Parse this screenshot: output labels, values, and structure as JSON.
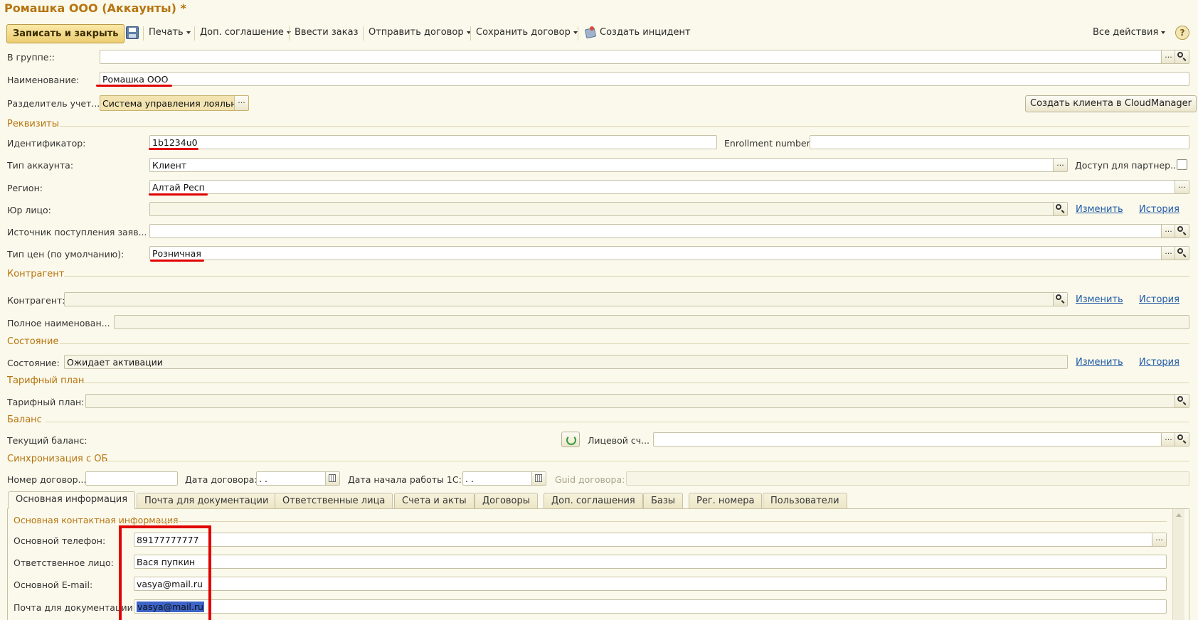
{
  "window_title": "Ромашка ООО (Аккаунты) *",
  "toolbar": {
    "save_close": "Записать и закрыть",
    "print": "Печать",
    "dop_sogl": "Доп. соглашение",
    "vvesti_zakaz": "Ввести заказ",
    "send_contract": "Отправить договор",
    "save_contract": "Сохранить договор",
    "create_incident": "Создать инцидент",
    "all_actions": "Все действия",
    "help": "?"
  },
  "form": {
    "v_gruppe_label": "В группе::",
    "v_gruppe_value": "",
    "name_label": "Наименование:",
    "name_value": "Ромашка ООО",
    "divider_label": "Разделитель учет...",
    "divider_value": "Система управления лояльн",
    "create_client_btn": "Создать клиента в CloudManager"
  },
  "sections": {
    "rekvizity": "Реквизиты",
    "kontragent": "Контрагент",
    "sostoyanie": "Состояние",
    "tarif": "Тарифный план",
    "balans": "Баланс",
    "sync": "Синхронизация с ОБ"
  },
  "rekvizity": {
    "id_label": "Идентификатор:",
    "id_value": "1b1234u0",
    "enroll_label": "Enrollment number:",
    "enroll_value": "",
    "type_label": "Тип аккаунта:",
    "type_value": "Клиент",
    "partner_label": "Доступ для партнер...",
    "region_label": "Регион:",
    "region_value": "Алтай Респ",
    "ur_label": "Юр лицо:",
    "ur_value": "",
    "source_label": "Источник поступления заяв...",
    "source_value": "",
    "price_label": "Тип цен (по умолчанию):",
    "price_value": "Розничная",
    "change": "Изменить",
    "history": "История"
  },
  "kontragent": {
    "label": "Контрагент:",
    "value": "",
    "full_name_label": "Полное наименован...",
    "full_name_value": ""
  },
  "sostoyanie": {
    "label": "Состояние:",
    "value": "Ожидает активации"
  },
  "tarif": {
    "label": "Тарифный план:",
    "value": ""
  },
  "balans": {
    "label": "Текущий баланс:",
    "account_label": "Лицевой сч...",
    "account_value": ""
  },
  "sync": {
    "contract_no_label": "Номер договор...",
    "contract_no_value": "",
    "contract_date_label": "Дата договора:",
    "contract_date_value": " .  .",
    "start_date_label": "Дата начала работы 1С:",
    "start_date_value": " .  .",
    "guid_label": "Guid договора:",
    "guid_value": ""
  },
  "tabs": [
    "Основная информация",
    "Почта для документации",
    "Ответственные лица",
    "Счета и акты",
    "Договоры",
    "Доп. соглашения",
    "Базы",
    "Рег. номера",
    "Пользователи"
  ],
  "contact": {
    "section": "Основная контактная информация",
    "phone_label": "Основной телефон:",
    "phone_value": "89177777777",
    "resp_label": "Ответственное лицо:",
    "resp_value": "Вася пупкин",
    "email_label": "Основной E-mail:",
    "email_value": "vasya@mail.ru",
    "docmail_label": "Почта для документации:",
    "docmail_value": "vasya@mail.ru"
  },
  "colors": {
    "accent": "#b6740f",
    "background": "#fbf9eb",
    "annotation_red": "#e00000",
    "link": "#1f5aa8"
  }
}
